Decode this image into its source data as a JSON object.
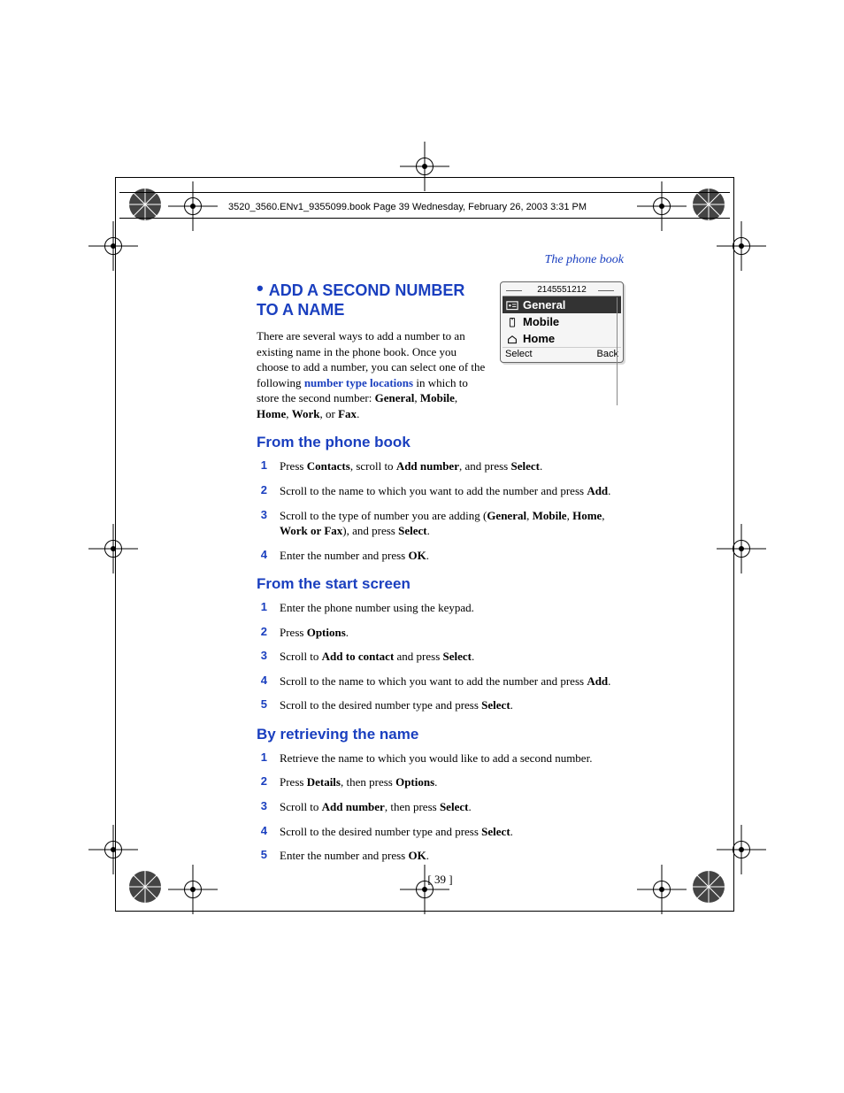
{
  "header_line": "3520_3560.ENv1_9355099.book  Page 39  Wednesday, February 26, 2003  3:31 PM",
  "section_label": "The phone book",
  "main_heading": "ADD A SECOND NUMBER TO A NAME",
  "intro": {
    "pre": "There are several ways to add a number to an existing name in the phone book. Once you choose to add a number, you can select one of the following ",
    "link": "number type locations",
    "post1": " in which to store the second number: ",
    "types": [
      "General",
      "Mobile",
      "Home",
      "Work",
      "Fax"
    ],
    "post2": "."
  },
  "phone": {
    "title": "2145551212",
    "rows": [
      "General",
      "Mobile",
      "Home"
    ],
    "left_soft": "Select",
    "right_soft": "Back"
  },
  "sections": [
    {
      "heading": "From the phone book",
      "steps": [
        {
          "pre": "Press ",
          "b1": "Contacts",
          "mid1": ", scroll to ",
          "b2": "Add number",
          "mid2": ", and press ",
          "b3": "Select",
          "post": "."
        },
        {
          "pre": "Scroll to the name to which you want to add the number and press ",
          "b1": "Add",
          "post": "."
        },
        {
          "pre": "Scroll to the type of number you are adding (",
          "b1": "General",
          "mid1": ", ",
          "b2": "Mobile",
          "mid2": ", ",
          "b3": "Home",
          "post1": ", ",
          "b4": "Work or Fax",
          "post2": "), and press ",
          "b5": "Select",
          "post3": "."
        },
        {
          "pre": "Enter the number and press ",
          "b1": "OK",
          "post": "."
        }
      ]
    },
    {
      "heading": "From the start screen",
      "steps": [
        {
          "pre": "Enter the phone number using the keypad."
        },
        {
          "pre": "Press ",
          "b1": "Options",
          "post": "."
        },
        {
          "pre": "Scroll to ",
          "b1": "Add to contact",
          "mid1": " and press ",
          "b2": "Select",
          "post": "."
        },
        {
          "pre": "Scroll to the name to which you want to add the number and press ",
          "b1": "Add",
          "post": "."
        },
        {
          "pre": "Scroll to the desired number type and press ",
          "b1": "Select",
          "post": "."
        }
      ]
    },
    {
      "heading": "By retrieving the name",
      "steps": [
        {
          "pre": "Retrieve the name to which you would like to add a second number."
        },
        {
          "pre": "Press ",
          "b1": "Details",
          "mid1": ", then press ",
          "b2": "Options",
          "post": "."
        },
        {
          "pre": "Scroll to ",
          "b1": "Add number",
          "mid1": ", then press ",
          "b2": "Select",
          "post": "."
        },
        {
          "pre": "Scroll to the desired number type and press ",
          "b1": "Select",
          "post": "."
        },
        {
          "pre": "Enter the number and press ",
          "b1": "OK",
          "post": "."
        }
      ]
    }
  ],
  "page_number": "[ 39 ]"
}
